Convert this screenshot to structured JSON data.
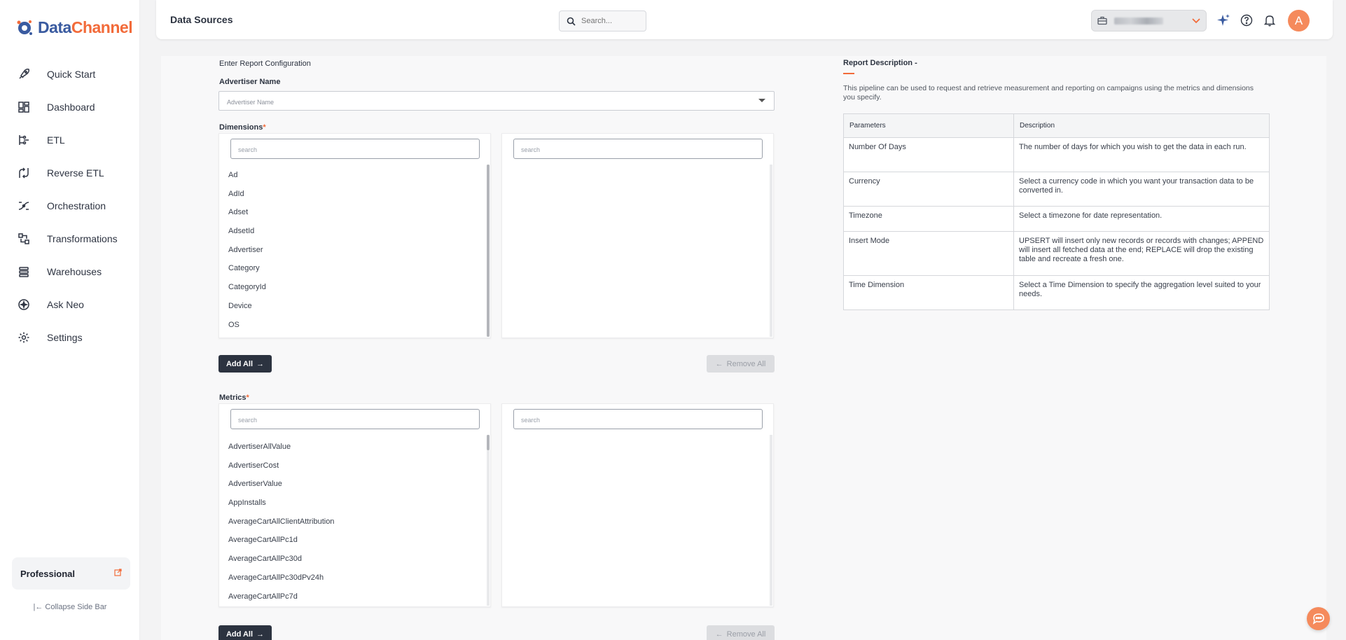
{
  "brand": {
    "name_part1": "Data",
    "name_part2": "Channel"
  },
  "sidebar": {
    "items": [
      {
        "label": "Quick Start",
        "icon": "rocket-icon"
      },
      {
        "label": "Dashboard",
        "icon": "dashboard-icon"
      },
      {
        "label": "ETL",
        "icon": "etl-icon"
      },
      {
        "label": "Reverse ETL",
        "icon": "reverse-etl-icon"
      },
      {
        "label": "Orchestration",
        "icon": "orchestration-icon"
      },
      {
        "label": "Transformations",
        "icon": "transformations-icon"
      },
      {
        "label": "Warehouses",
        "icon": "warehouses-icon"
      },
      {
        "label": "Ask Neo",
        "icon": "ask-neo-icon"
      },
      {
        "label": "Settings",
        "icon": "settings-icon"
      }
    ],
    "plan": "Professional",
    "collapse_label": "Collapse Side Bar"
  },
  "header": {
    "title": "Data Sources",
    "search_placeholder": "Search...",
    "avatar_initial": "A"
  },
  "form": {
    "section_label": "Enter Report Configuration",
    "advertiser_label": "Advertiser Name",
    "advertiser_placeholder": "Advertiser Name",
    "dimensions_label": "Dimensions",
    "metrics_label": "Metrics",
    "search_placeholder": "search",
    "dimensions": [
      "Ad",
      "AdId",
      "Adset",
      "AdsetId",
      "Advertiser",
      "Category",
      "CategoryId",
      "Device",
      "OS"
    ],
    "metrics": [
      "AdvertiserAllValue",
      "AdvertiserCost",
      "AdvertiserValue",
      "AppInstalls",
      "AverageCartAllClientAttribution",
      "AverageCartAllPc1d",
      "AverageCartAllPc30d",
      "AverageCartAllPc30dPv24h",
      "AverageCartAllPc7d"
    ],
    "add_all": "Add All",
    "remove_all": "Remove All"
  },
  "report": {
    "title": "Report Description -",
    "description": "This pipeline can be used to request and retrieve measurement and reporting on campaigns using the metrics and dimensions you specify.",
    "columns": [
      "Parameters",
      "Description"
    ],
    "rows": [
      {
        "param": "Number Of Days",
        "desc": "The number of days for which you wish to get the data in each run."
      },
      {
        "param": "Currency",
        "desc": "Select a currency code in which you want your transaction data to be converted in."
      },
      {
        "param": "Timezone",
        "desc": "Select a timezone for date representation."
      },
      {
        "param": "Insert Mode",
        "desc": "UPSERT will insert only new records or records with changes; APPEND will insert all fetched data at the end; REPLACE will drop the existing table and recreate a fresh one."
      },
      {
        "param": "Time Dimension",
        "desc": "Select a Time Dimension to specify the aggregation level suited to your needs."
      }
    ]
  },
  "colors": {
    "accent": "#f26b3a",
    "brand_blue": "#3a5ba0",
    "dark": "#2c3340"
  }
}
